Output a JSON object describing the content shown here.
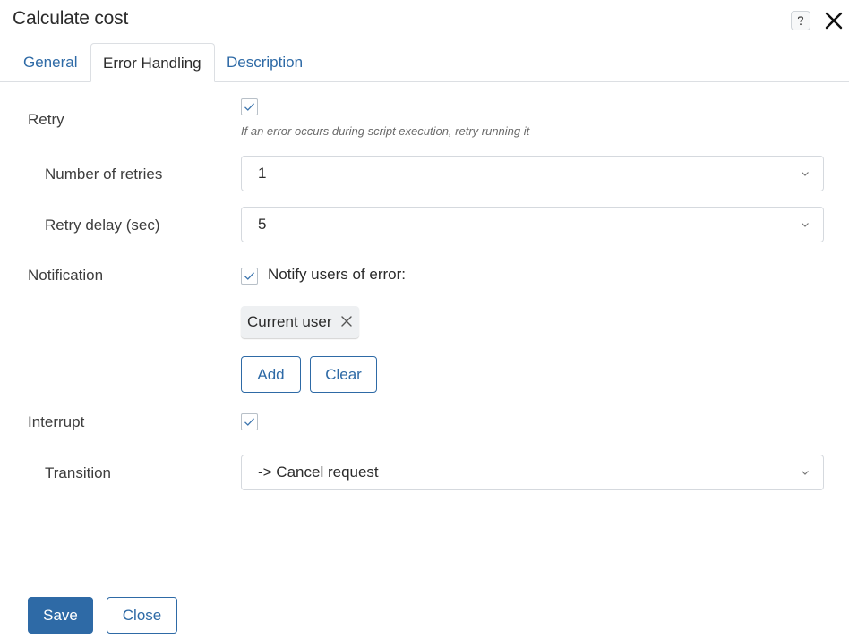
{
  "dialog": {
    "title": "Calculate cost",
    "help_icon": "question-icon",
    "close_icon": "close-icon"
  },
  "tabs": [
    {
      "label": "General",
      "active": false
    },
    {
      "label": "Error Handling",
      "active": true
    },
    {
      "label": "Description",
      "active": false
    }
  ],
  "form": {
    "retry": {
      "label": "Retry",
      "checked": true,
      "hint": "If an error occurs during script execution, retry running it"
    },
    "number_of_retries": {
      "label": "Number of retries",
      "value": "1"
    },
    "retry_delay": {
      "label": "Retry delay (sec)",
      "value": "5"
    },
    "notification": {
      "label": "Notification",
      "checked": true,
      "checkbox_label": "Notify users of error:",
      "users": [
        {
          "name": "Current user"
        }
      ],
      "add_label": "Add",
      "clear_label": "Clear"
    },
    "interrupt": {
      "label": "Interrupt",
      "checked": true
    },
    "transition": {
      "label": "Transition",
      "value": "-> Cancel request"
    }
  },
  "footer": {
    "save_label": "Save",
    "close_label": "Close"
  },
  "colors": {
    "accent": "#2e6aa6",
    "border": "#d5d9de",
    "text": "#2b2b2b"
  }
}
